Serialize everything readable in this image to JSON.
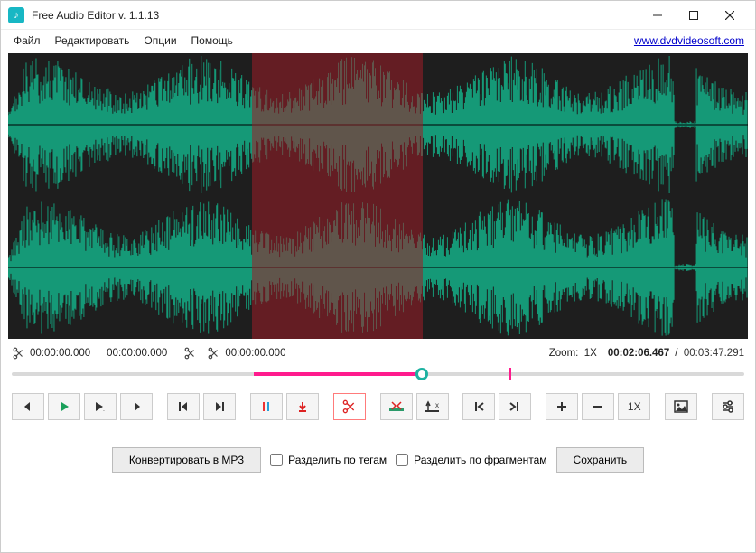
{
  "window": {
    "title": "Free Audio Editor v. 1.1.13"
  },
  "menu": {
    "file": "Файл",
    "edit": "Редактировать",
    "options": "Опции",
    "help": "Помощь",
    "site_link": "www.dvdvideosoft.com"
  },
  "timecodes": {
    "sel_start": "00:00:00.000",
    "sel_end": "00:00:00.000",
    "split_point": "00:00:00.000",
    "zoom_label": "Zoom:",
    "zoom_value": "1X",
    "current": "00:02:06.467",
    "separator": "/",
    "total": "00:03:47.291"
  },
  "seek": {
    "sel_start_pct": 33,
    "sel_end_pct": 56,
    "marker_pct": 68
  },
  "waveform": {
    "sel_start_pct": 33,
    "sel_end_pct": 56
  },
  "toolbar": {
    "zoom_1x": "1X"
  },
  "bottom": {
    "convert": "Конвертировать в MP3",
    "split_tags": "Разделить по тегам",
    "split_fragments": "Разделить по фрагментам",
    "save": "Сохранить"
  },
  "colors": {
    "wave_green": "#15a07c",
    "wave_dark": "#0a0a0a",
    "selection": "rgba(158,30,40,0.55)",
    "pink": "#ff1b8d",
    "teal": "#1db2a1"
  }
}
